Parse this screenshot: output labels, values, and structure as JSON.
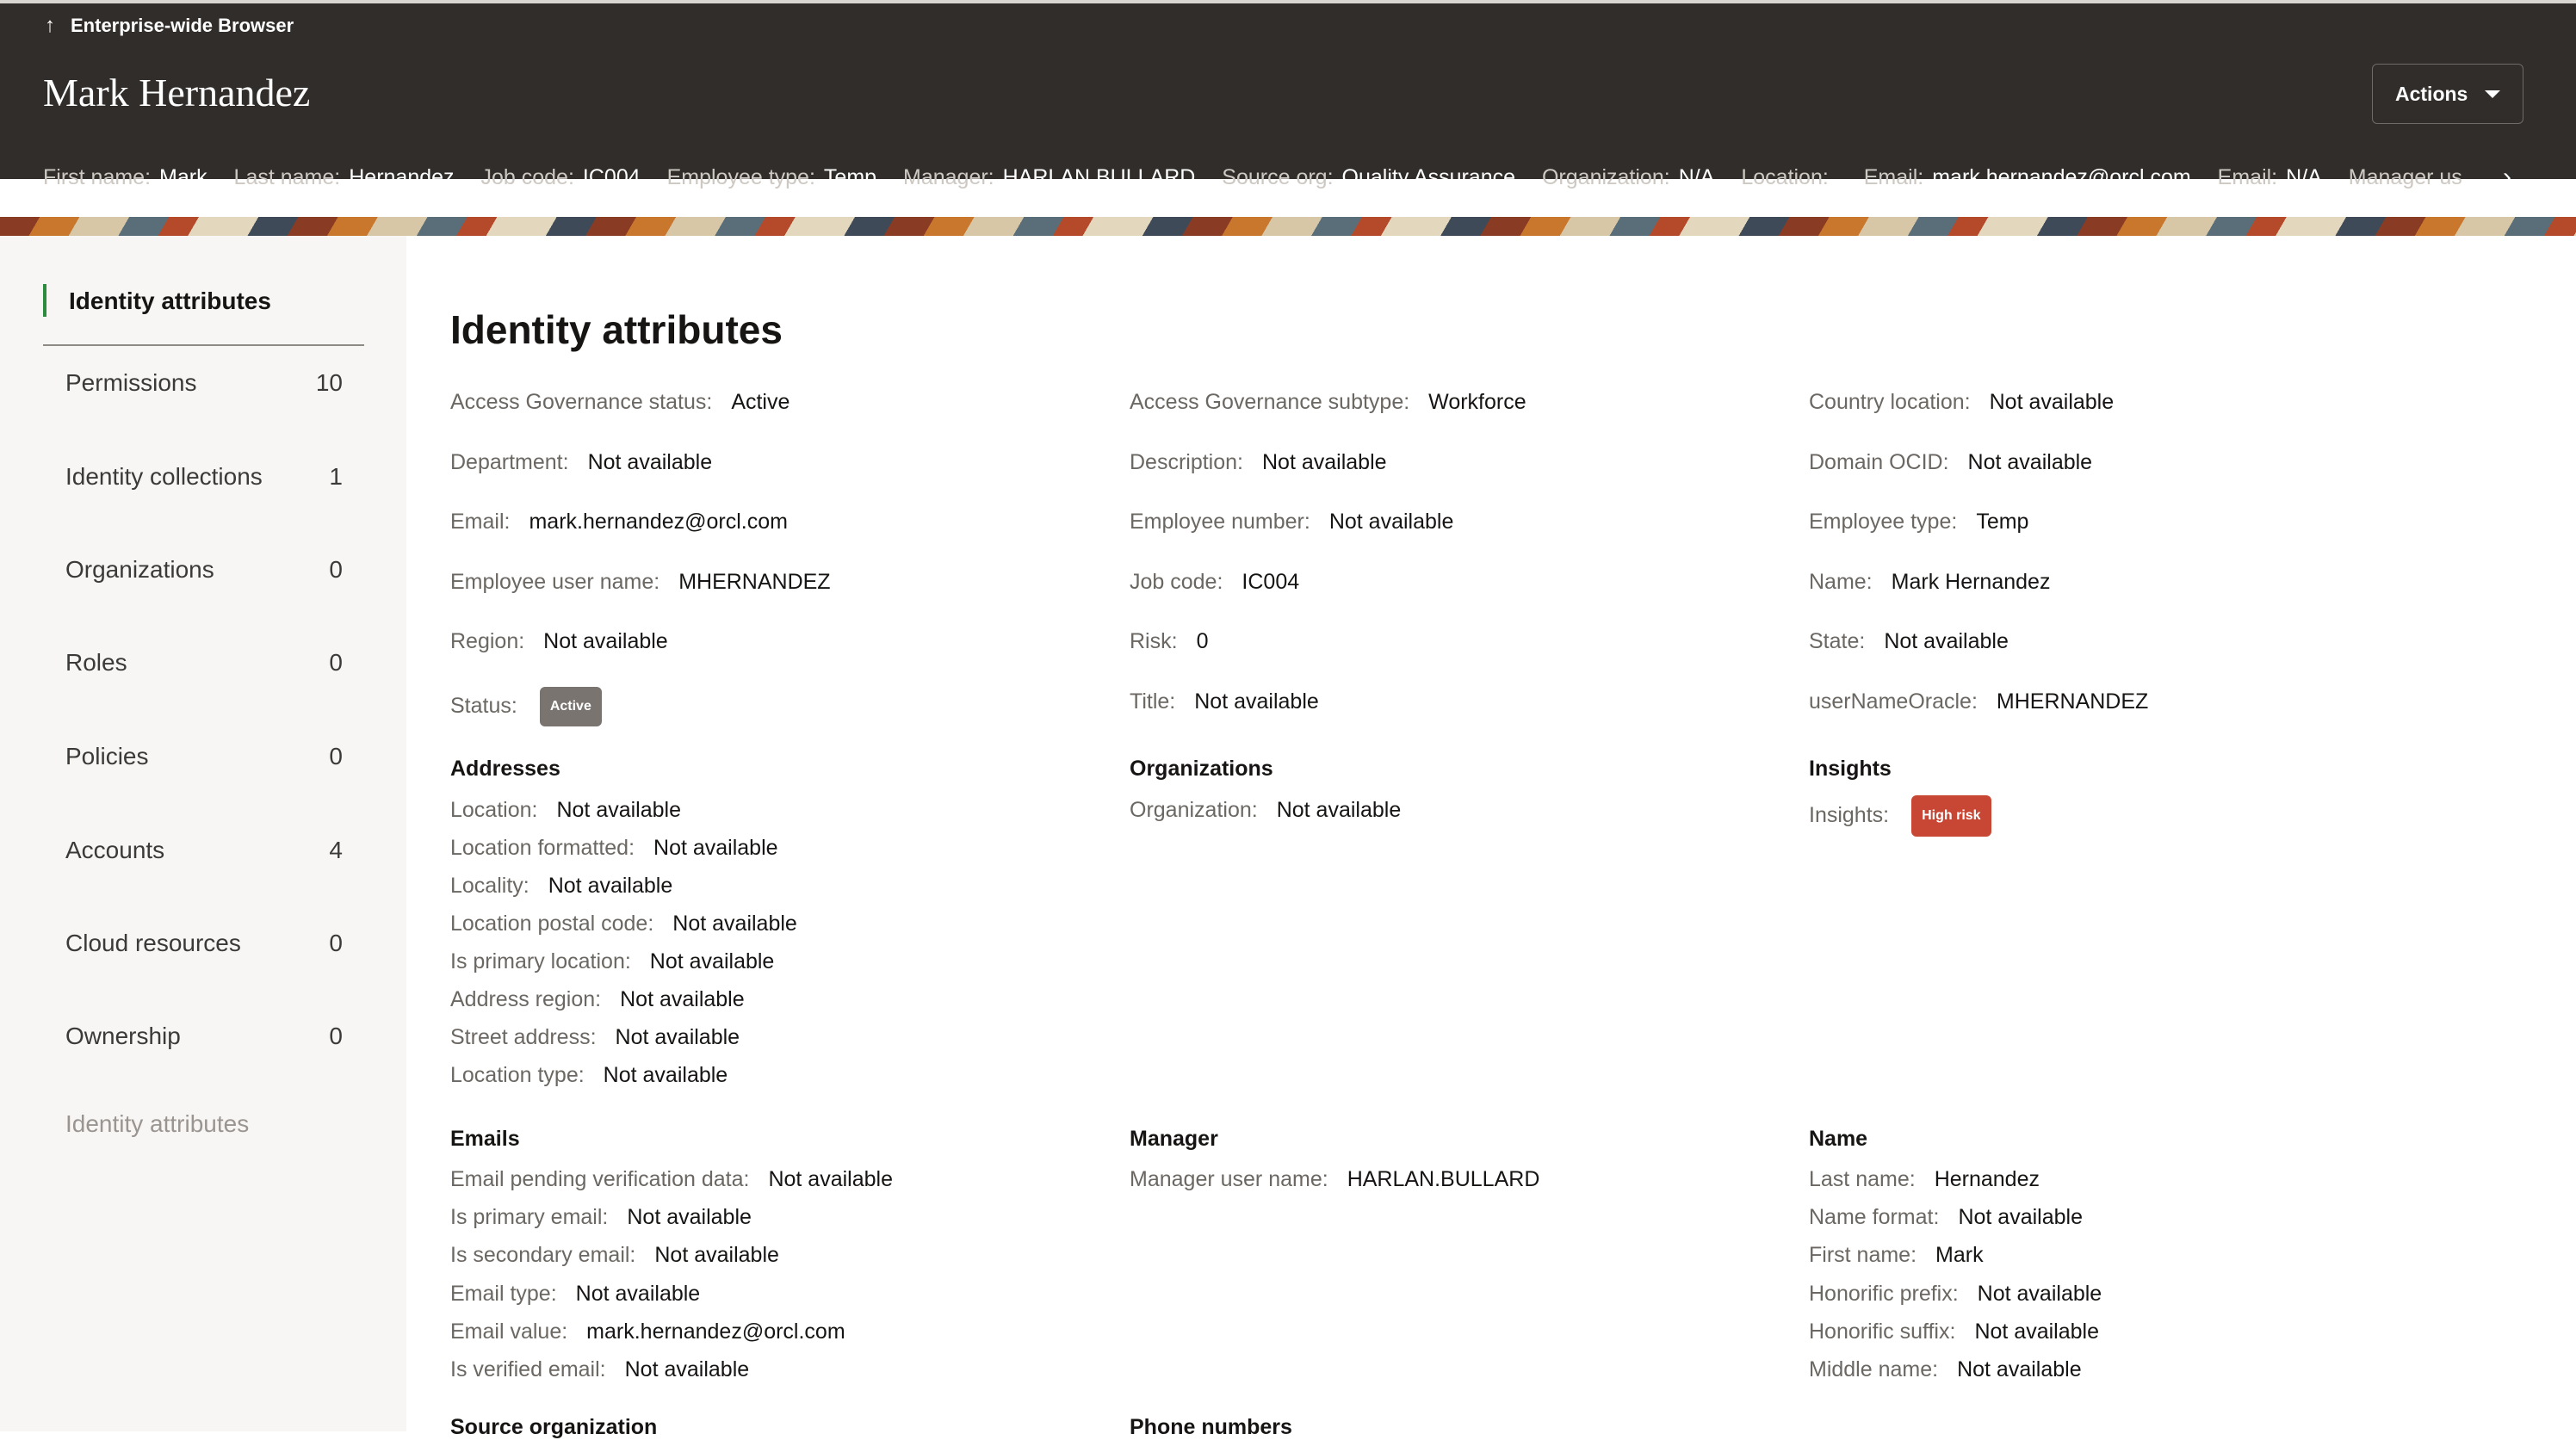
{
  "header": {
    "back_label": "Enterprise-wide Browser",
    "title": "Mark Hernandez",
    "actions_label": "Actions",
    "summary": [
      {
        "label": "First name:",
        "value": "Mark"
      },
      {
        "label": "Last name:",
        "value": "Hernandez"
      },
      {
        "label": "Job code:",
        "value": "IC004"
      },
      {
        "label": "Employee type:",
        "value": "Temp"
      },
      {
        "label": "Manager:",
        "value": "HARLAN.BULLARD"
      },
      {
        "label": "Source org:",
        "value": "Quality Assurance"
      },
      {
        "label": "Organization:",
        "value": "N/A"
      },
      {
        "label": "Location:",
        "value": ""
      },
      {
        "label": "Email:",
        "value": "mark.hernandez@orcl.com"
      },
      {
        "label": "Email:",
        "value": "N/A"
      },
      {
        "label": "Manager us",
        "value": ""
      }
    ]
  },
  "sidebar": {
    "active": "Identity attributes",
    "items": [
      {
        "label": "Permissions",
        "count": "10"
      },
      {
        "label": "Identity collections",
        "count": "1"
      },
      {
        "label": "Organizations",
        "count": "0"
      },
      {
        "label": "Roles",
        "count": "0"
      },
      {
        "label": "Policies",
        "count": "0"
      },
      {
        "label": "Accounts",
        "count": "4"
      },
      {
        "label": "Cloud resources",
        "count": "0"
      },
      {
        "label": "Ownership",
        "count": "0"
      }
    ],
    "footer_item": "Identity attributes"
  },
  "main": {
    "title": "Identity attributes",
    "attributes": [
      {
        "label": "Access Governance status:",
        "value": "Active"
      },
      {
        "label": "Access Governance subtype:",
        "value": "Workforce"
      },
      {
        "label": "Country location:",
        "value": "Not available"
      },
      {
        "label": "Department:",
        "value": "Not available"
      },
      {
        "label": "Description:",
        "value": "Not available"
      },
      {
        "label": "Domain OCID:",
        "value": "Not available"
      },
      {
        "label": "Email:",
        "value": "mark.hernandez@orcl.com"
      },
      {
        "label": "Employee number:",
        "value": "Not available"
      },
      {
        "label": "Employee type:",
        "value": "Temp"
      },
      {
        "label": "Employee user name:",
        "value": "MHERNANDEZ"
      },
      {
        "label": "Job code:",
        "value": "IC004"
      },
      {
        "label": "Name:",
        "value": "Mark Hernandez"
      },
      {
        "label": "Region:",
        "value": "Not available"
      },
      {
        "label": "Risk:",
        "value": "0"
      },
      {
        "label": "State:",
        "value": "Not available"
      },
      {
        "label": "Status:",
        "value": "Active"
      },
      {
        "label": "Title:",
        "value": "Not available"
      },
      {
        "label": "userNameOracle:",
        "value": "MHERNANDEZ"
      }
    ],
    "addresses": {
      "title": "Addresses",
      "rows": [
        {
          "label": "Location:",
          "value": "Not available"
        },
        {
          "label": "Location formatted:",
          "value": "Not available"
        },
        {
          "label": "Locality:",
          "value": "Not available"
        },
        {
          "label": "Location postal code:",
          "value": "Not available"
        },
        {
          "label": "Is primary location:",
          "value": "Not available"
        },
        {
          "label": "Address region:",
          "value": "Not available"
        },
        {
          "label": "Street address:",
          "value": "Not available"
        },
        {
          "label": "Location type:",
          "value": "Not available"
        }
      ]
    },
    "organizations": {
      "title": "Organizations",
      "rows": [
        {
          "label": "Organization:",
          "value": "Not available"
        }
      ]
    },
    "insights": {
      "title": "Insights",
      "label": "Insights:",
      "badge": "High risk"
    },
    "emails": {
      "title": "Emails",
      "rows": [
        {
          "label": "Email pending verification data:",
          "value": "Not available"
        },
        {
          "label": "Is primary email:",
          "value": "Not available"
        },
        {
          "label": "Is secondary email:",
          "value": "Not available"
        },
        {
          "label": "Email type:",
          "value": "Not available"
        },
        {
          "label": "Email value:",
          "value": "mark.hernandez@orcl.com"
        },
        {
          "label": "Is verified email:",
          "value": "Not available"
        }
      ]
    },
    "manager": {
      "title": "Manager",
      "rows": [
        {
          "label": "Manager user name:",
          "value": "HARLAN.BULLARD"
        }
      ]
    },
    "name": {
      "title": "Name",
      "rows": [
        {
          "label": "Last name:",
          "value": "Hernandez"
        },
        {
          "label": "Name format:",
          "value": "Not available"
        },
        {
          "label": "First name:",
          "value": "Mark"
        },
        {
          "label": "Honorific prefix:",
          "value": "Not available"
        },
        {
          "label": "Honorific suffix:",
          "value": "Not available"
        },
        {
          "label": "Middle name:",
          "value": "Not available"
        }
      ]
    },
    "source_org": {
      "title": "Source organization"
    },
    "phone_numbers": {
      "title": "Phone numbers"
    }
  }
}
